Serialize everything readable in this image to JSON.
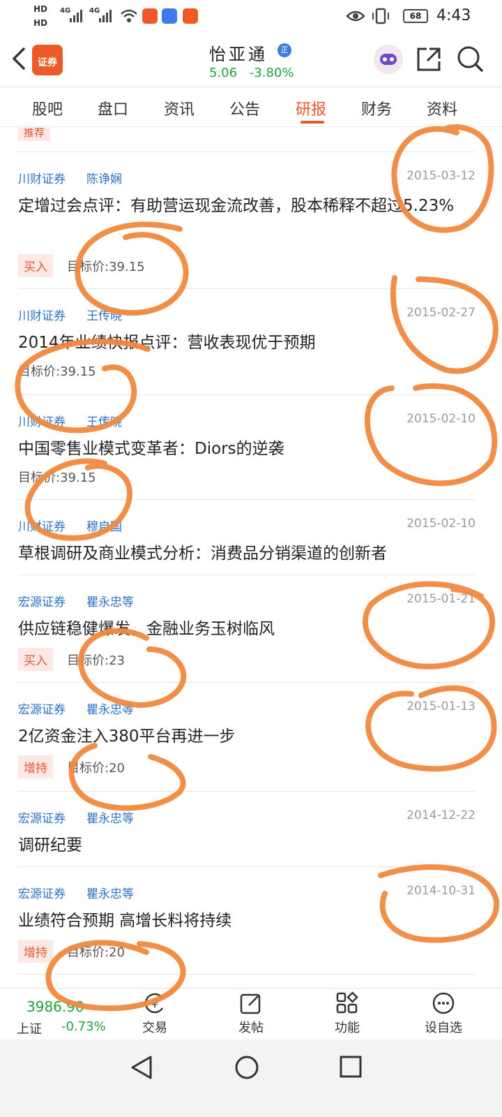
{
  "status": {
    "hd1": "HD",
    "hd2": "HD",
    "net1": "4G",
    "net2": "4G",
    "battery": "68",
    "time": "4:43"
  },
  "header": {
    "title": "怡亚通",
    "badge": "正",
    "logo_text": "证券",
    "price": "5.06",
    "change": "-3.80%"
  },
  "tabs": [
    "股吧",
    "盘口",
    "资讯",
    "公告",
    "研报",
    "财务",
    "资料"
  ],
  "active_tab": "研报",
  "partial_badge": "推荐",
  "reports": [
    {
      "source": "川财证券",
      "author": "陈诤娴",
      "date": "2015-03-12",
      "title": "定增过会点评：有助营运现金流改善，股本稀释不超过5.23%",
      "rating": "买入",
      "target": "目标价:39.15"
    },
    {
      "source": "川财证券",
      "author": "王传晓",
      "date": "2015-02-27",
      "title": "2014年业绩快报点评：营收表现优于预期",
      "rating": "",
      "target": "目标价:39.15"
    },
    {
      "source": "川财证券",
      "author": "王传晓",
      "date": "2015-02-10",
      "title": "中国零售业模式变革者：Diors的逆袭",
      "rating": "",
      "target": "目标价:39.15"
    },
    {
      "source": "川财证券",
      "author": "穆启国",
      "date": "2015-02-10",
      "title": "草根调研及商业模式分析：消费品分销渠道的创新者",
      "rating": "",
      "target": ""
    },
    {
      "source": "宏源证券",
      "author": "瞿永忠等",
      "date": "2015-01-21",
      "title": "供应链稳健爆发，金融业务玉树临风",
      "rating": "买入",
      "target": "目标价:23"
    },
    {
      "source": "宏源证券",
      "author": "瞿永忠等",
      "date": "2015-01-13",
      "title": "2亿资金注入380平台再进一步",
      "rating": "增持",
      "target": "目标价:20"
    },
    {
      "source": "宏源证券",
      "author": "瞿永忠等",
      "date": "2014-12-22",
      "title": "调研纪要",
      "rating": "",
      "target": ""
    },
    {
      "source": "宏源证券",
      "author": "瞿永忠等",
      "date": "2014-10-31",
      "title": "业绩符合预期 高增长料将持续",
      "rating": "增持",
      "target": "目标价:20"
    }
  ],
  "bottom": {
    "index_value": "3986.90",
    "index_name": "上证",
    "index_change": "-0.73%",
    "nav": [
      {
        "label": "交易",
        "icon": "yuan-icon"
      },
      {
        "label": "发帖",
        "icon": "edit-icon"
      },
      {
        "label": "功能",
        "icon": "grid-icon"
      },
      {
        "label": "设自选",
        "icon": "more-icon"
      }
    ]
  },
  "colors": {
    "accent": "#e8592a",
    "link": "#2a72c8",
    "down": "#1ea43a",
    "scribble": "#f0893e"
  }
}
